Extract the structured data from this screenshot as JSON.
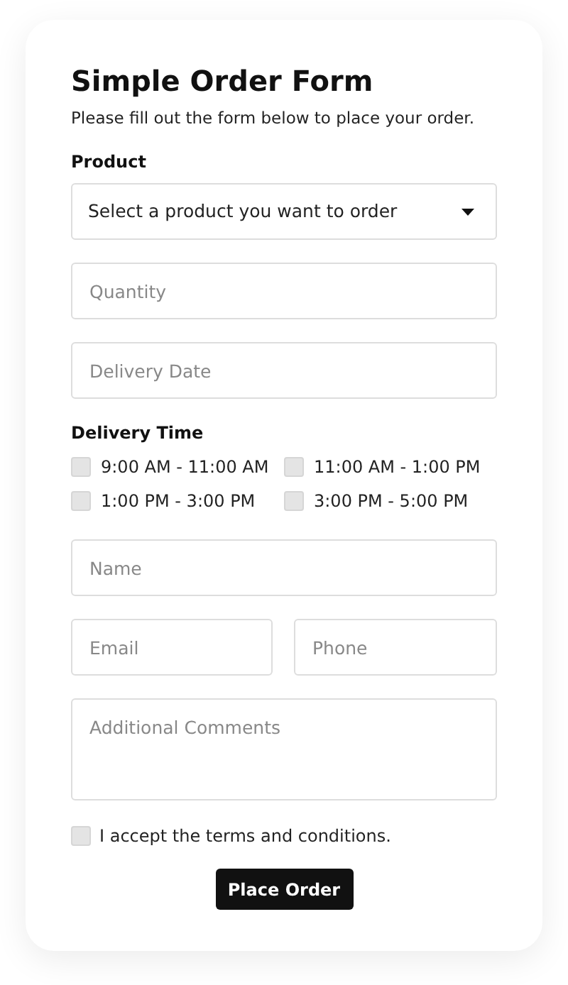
{
  "title": "Simple Order Form",
  "subtitle": "Please fill out the form below to place your order.",
  "product": {
    "label": "Product",
    "value": "Select a product you want to order"
  },
  "quantity": {
    "placeholder": "Quantity"
  },
  "delivery_date": {
    "placeholder": "Delivery Date"
  },
  "delivery_time": {
    "label": "Delivery Time",
    "options": [
      {
        "label": "9:00 AM - 11:00 AM",
        "checked": false
      },
      {
        "label": "11:00 AM - 1:00 PM",
        "checked": false
      },
      {
        "label": "1:00 PM - 3:00 PM",
        "checked": false
      },
      {
        "label": "3:00 PM - 5:00 PM",
        "checked": false
      }
    ]
  },
  "name": {
    "placeholder": "Name"
  },
  "email": {
    "placeholder": "Email"
  },
  "phone": {
    "placeholder": "Phone"
  },
  "comments": {
    "placeholder": "Additional Comments"
  },
  "terms": {
    "label": "I accept the terms and conditions.",
    "checked": false
  },
  "submit": "Place Order"
}
